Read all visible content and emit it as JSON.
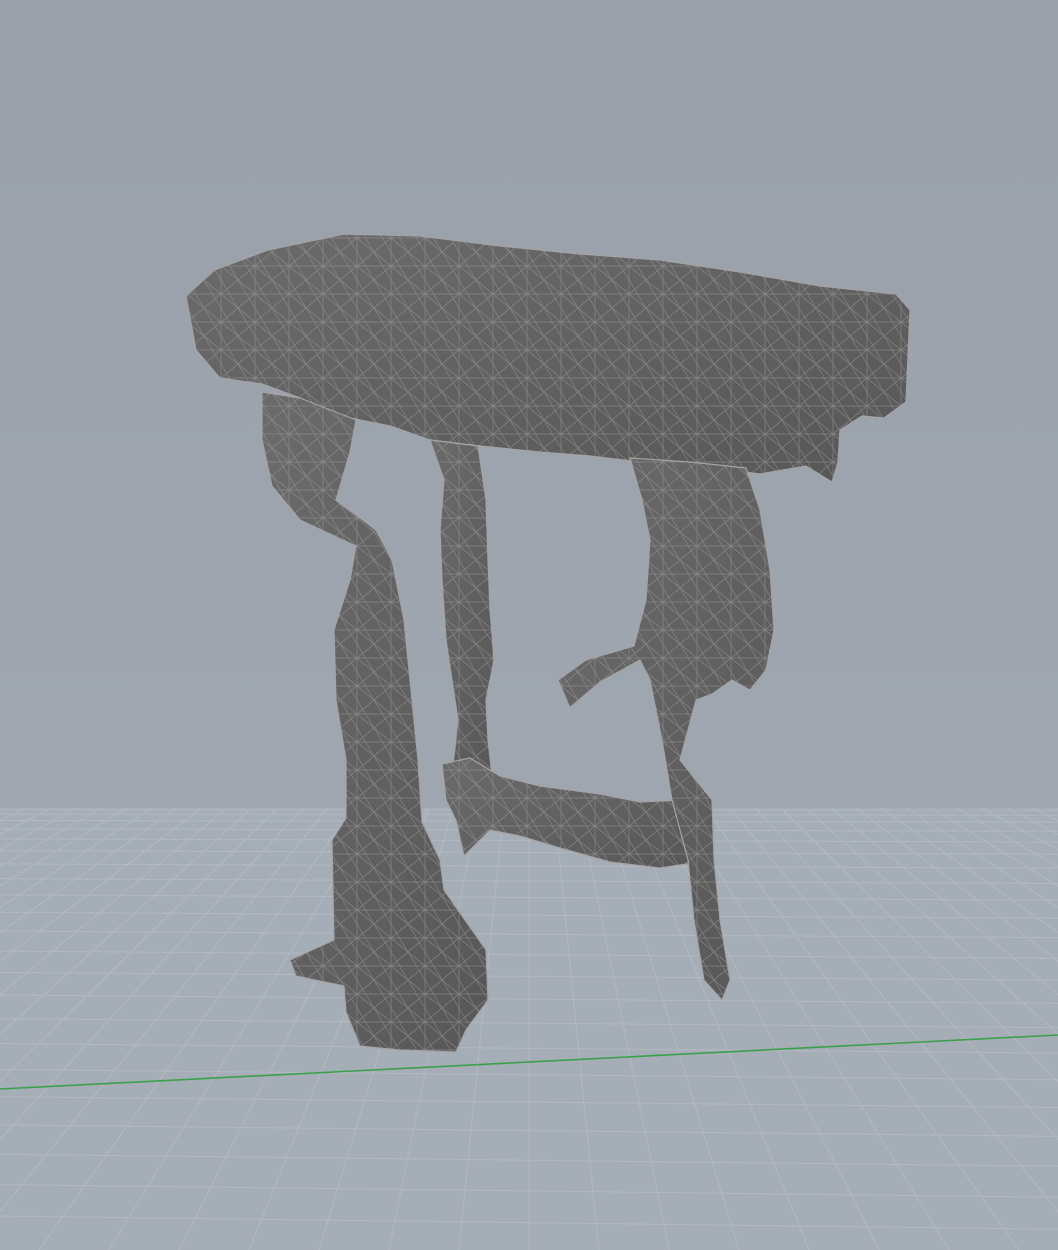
{
  "viewport": {
    "colors": {
      "background_top": "#99a0aa",
      "background_bottom": "#a3aab4",
      "floor": "#a5adb7",
      "grid_line": "#b2b9c2",
      "x_axis": "#3aa14a",
      "mesh_fill": "#6b6b6b",
      "mesh_shadow": "#575757",
      "wire": "#a4a4a4"
    },
    "grid": true,
    "object_icon": "stone-table-mesh"
  }
}
